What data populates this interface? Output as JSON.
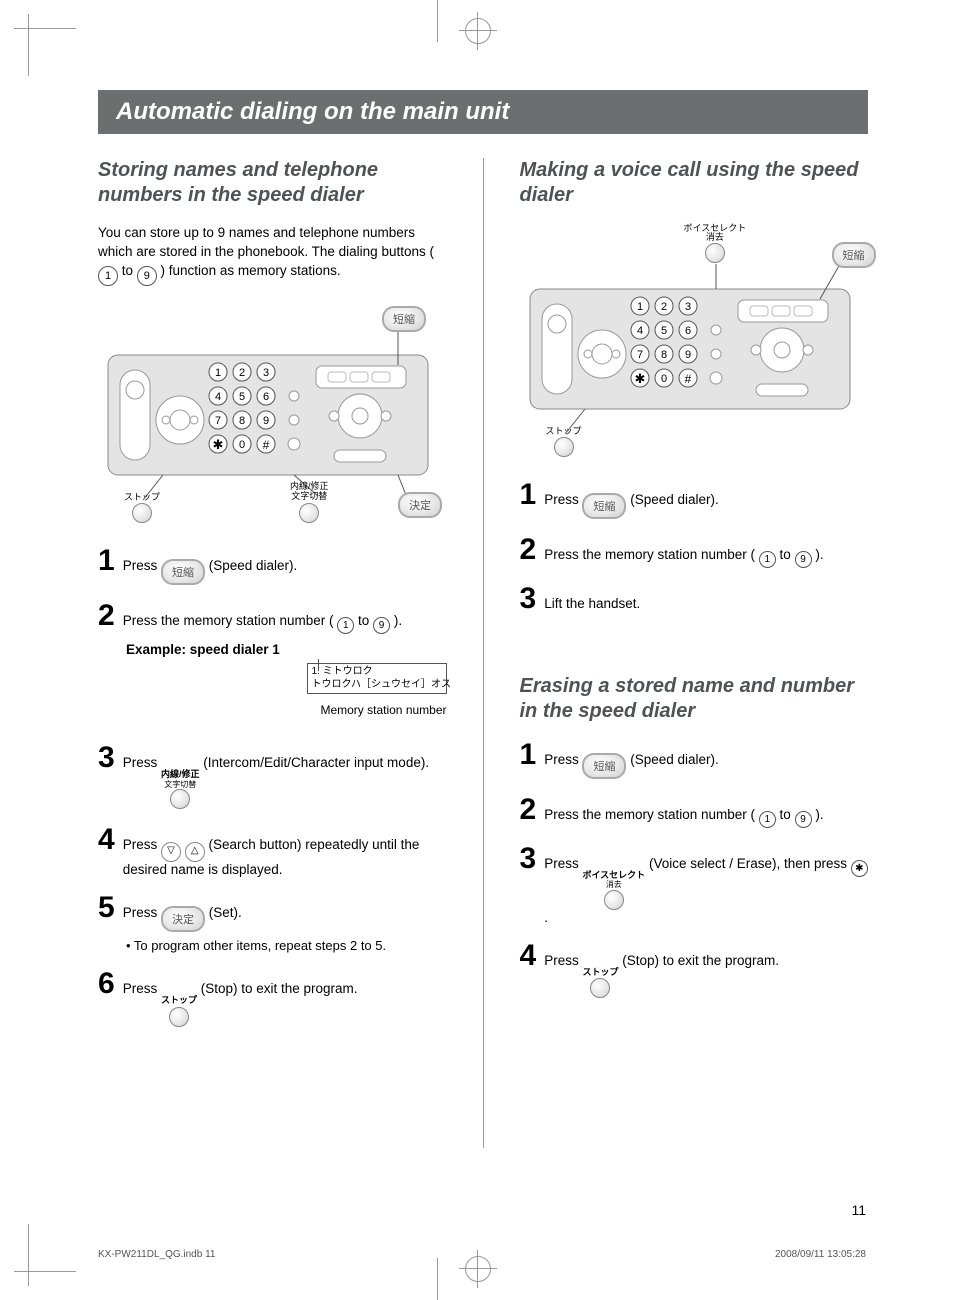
{
  "header_bar": "Automatic dialing on the main unit",
  "left": {
    "h2": "Storing names and telephone numbers in the speed dialer",
    "intro_a": "You can store up to 9 names and telephone numbers which are stored in the phonebook. The dialing buttons (",
    "intro_to": " to ",
    "intro_b": ") function as memory stations.",
    "labels": {
      "speed_dialer_oval": "短縮",
      "set_oval": "決定",
      "stop_oval_label": "ストップ",
      "intercom_label_1": "内線/修正",
      "intercom_label_2": "文字切替"
    },
    "steps": {
      "s1_a": "Press ",
      "s1_b": " (Speed dialer).",
      "s2_a": "Press the memory station number (",
      "s2_to": " to ",
      "s2_b": ").",
      "example": "Example: speed dialer 1",
      "lcd_line1": "1. ミトウロク",
      "lcd_line2": "トウロクハ［シュウセイ］オス",
      "mem_caption": "Memory station number",
      "s3_a": "Press ",
      "s3_b": " (Intercom/Edit/Character input mode).",
      "s4_a": "Press ",
      "s4_b": " (Search button) repeatedly until the desired name is displayed.",
      "s5_a": "Press ",
      "s5_b": " (Set).",
      "s5_bullet": "• To program other items, repeat steps 2 to 5.",
      "s6_a": "Press ",
      "s6_b": " (Stop) to exit the program."
    }
  },
  "right": {
    "h2a": "Making a voice call using the speed dialer",
    "labels": {
      "voice_erase_1": "ボイスセレクト",
      "voice_erase_2": "消去",
      "speed_dialer_oval": "短縮",
      "stop_label": "ストップ"
    },
    "stepsA": {
      "s1_a": "Press ",
      "s1_b": " (Speed dialer).",
      "s2_a": "Press the memory station number (",
      "s2_to": " to ",
      "s2_b": ").",
      "s3": "Lift the handset."
    },
    "h2b": "Erasing a stored name and number in the speed dialer",
    "stepsB": {
      "s1_a": "Press ",
      "s1_b": " (Speed dialer).",
      "s2_a": "Press the memory station number (",
      "s2_to": " to ",
      "s2_b": ").",
      "s3_a": "Press ",
      "s3_b": " (Voice select / Erase), then press ",
      "s3_c": ".",
      "s4_a": "Press ",
      "s4_b": " (Stop) to exit the program."
    }
  },
  "page_number": "11",
  "print_footer": {
    "left": "KX-PW211DL_QG.indb   11",
    "right": "2008/09/11   13:05:28"
  }
}
